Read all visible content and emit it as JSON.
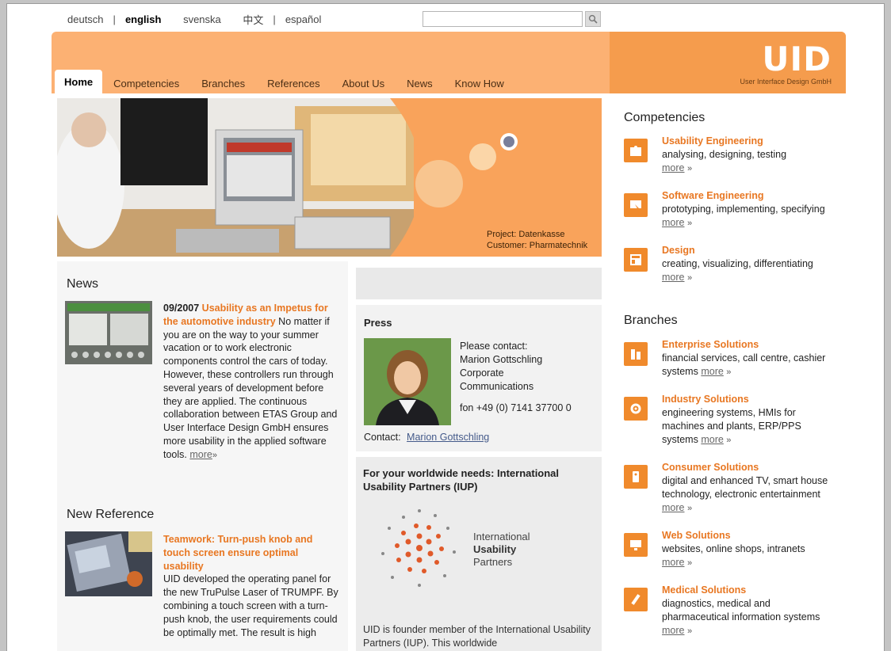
{
  "languages": [
    {
      "label": "deutsch",
      "active": false
    },
    {
      "label": "english",
      "active": true
    },
    {
      "label": "svenska",
      "active": false
    },
    {
      "label": "中文",
      "active": false
    },
    {
      "label": "español",
      "active": false
    }
  ],
  "search": {
    "placeholder": "",
    "value": ""
  },
  "brand": {
    "logo": "UID",
    "tagline": "User Interface Design GmbH"
  },
  "nav": [
    "Home",
    "Competencies",
    "Branches",
    "References",
    "About Us",
    "News",
    "Know How"
  ],
  "hero": {
    "caption_line1": "Project: Datenkasse",
    "caption_line2": "Customer: Pharmatechnik"
  },
  "news": {
    "title": "News",
    "date": "09/2007",
    "headline": "Usability as an Impetus for the automotive industry",
    "body": "No matter if you are on the way to your summer vacation or to work electronic components control the cars of today. However, these controllers run through several years of development before they are applied. The continuous collaboration between ETAS Group and User Interface Design GmbH ensures more usability in the applied software tools.",
    "more": "more"
  },
  "reference": {
    "title": "New Reference",
    "headline": "Teamwork: Turn-push knob and touch screen ensure optimal usability",
    "body": "UID developed the operating panel for the new TruPulse Laser of TRUMPF. By combining a touch screen with a turn-push knob, the user requirements could be optimally met. The result is high"
  },
  "press": {
    "title": "Press",
    "line1": "Please contact:",
    "line2": "Marion Gottschling",
    "line3": "Corporate",
    "line4": "Communications",
    "phone": "fon +49 (0) 7141 37700 0",
    "contact_label": "Contact:",
    "contact_link": "Marion Gottschling"
  },
  "iup": {
    "title": "For your worldwide needs: International Usability Partners (IUP)",
    "logo_line1": "International",
    "logo_line2": "Usability",
    "logo_line3": "Partners",
    "text": "UID is founder member of the International Usability Partners (IUP). This worldwide"
  },
  "competencies": {
    "title": "Competencies",
    "items": [
      {
        "title": "Usability Engineering",
        "text": "analysing, designing, testing",
        "more": "more"
      },
      {
        "title": "Software Engineering",
        "text": "prototyping, implementing, specifying",
        "more": "more"
      },
      {
        "title": "Design",
        "text": "creating, visualizing, differentiating",
        "more": "more"
      }
    ]
  },
  "branches": {
    "title": "Branches",
    "items": [
      {
        "title": "Enterprise Solutions",
        "text": "financial services, call centre, cashier systems",
        "more": "more"
      },
      {
        "title": "Industry Solutions",
        "text": "engineering systems, HMIs for machines and plants, ERP/PPS systems",
        "more": "more"
      },
      {
        "title": "Consumer Solutions",
        "text": "digital and enhanced TV, smart house technology, electronic entertainment",
        "more": "more"
      },
      {
        "title": "Web Solutions",
        "text": "websites, online shops, intranets",
        "more": "more"
      },
      {
        "title": "Medical Solutions",
        "text": "diagnostics, medical and pharmaceutical information systems",
        "more": "more"
      }
    ]
  },
  "colors": {
    "accent": "#e87722",
    "header": "#fcb173",
    "brand_block": "#f59c4d"
  }
}
